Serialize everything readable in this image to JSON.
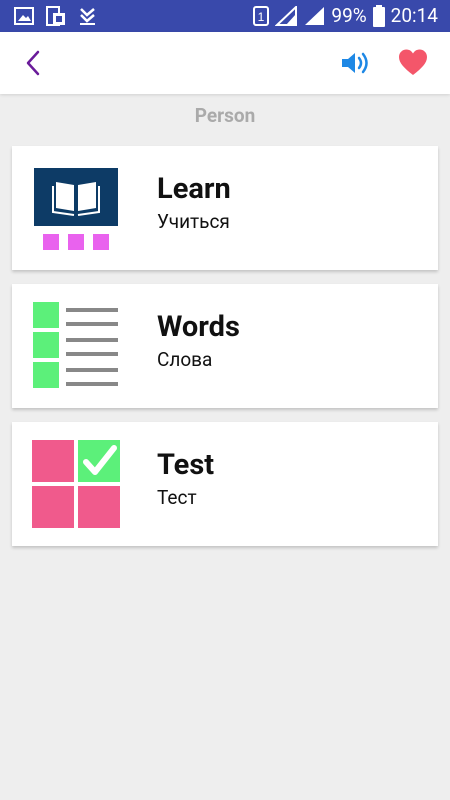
{
  "status_bar": {
    "battery_percent": "99%",
    "time": "20:14",
    "sim_badge": "1"
  },
  "app_bar": {
    "back_icon": "chevron-left-icon",
    "speaker_icon": "speaker-icon",
    "favorite_icon": "heart-icon",
    "accent_color": "#6a1b9a",
    "speaker_color": "#1e88e5",
    "heart_color": "#f4566a"
  },
  "section": {
    "title": "Person"
  },
  "menu": [
    {
      "title": "Learn",
      "subtitle": "Учиться",
      "icon": "book-icon"
    },
    {
      "title": "Words",
      "subtitle": "Слова",
      "icon": "word-list-icon"
    },
    {
      "title": "Test",
      "subtitle": "Тест",
      "icon": "test-checkmark-icon"
    }
  ]
}
